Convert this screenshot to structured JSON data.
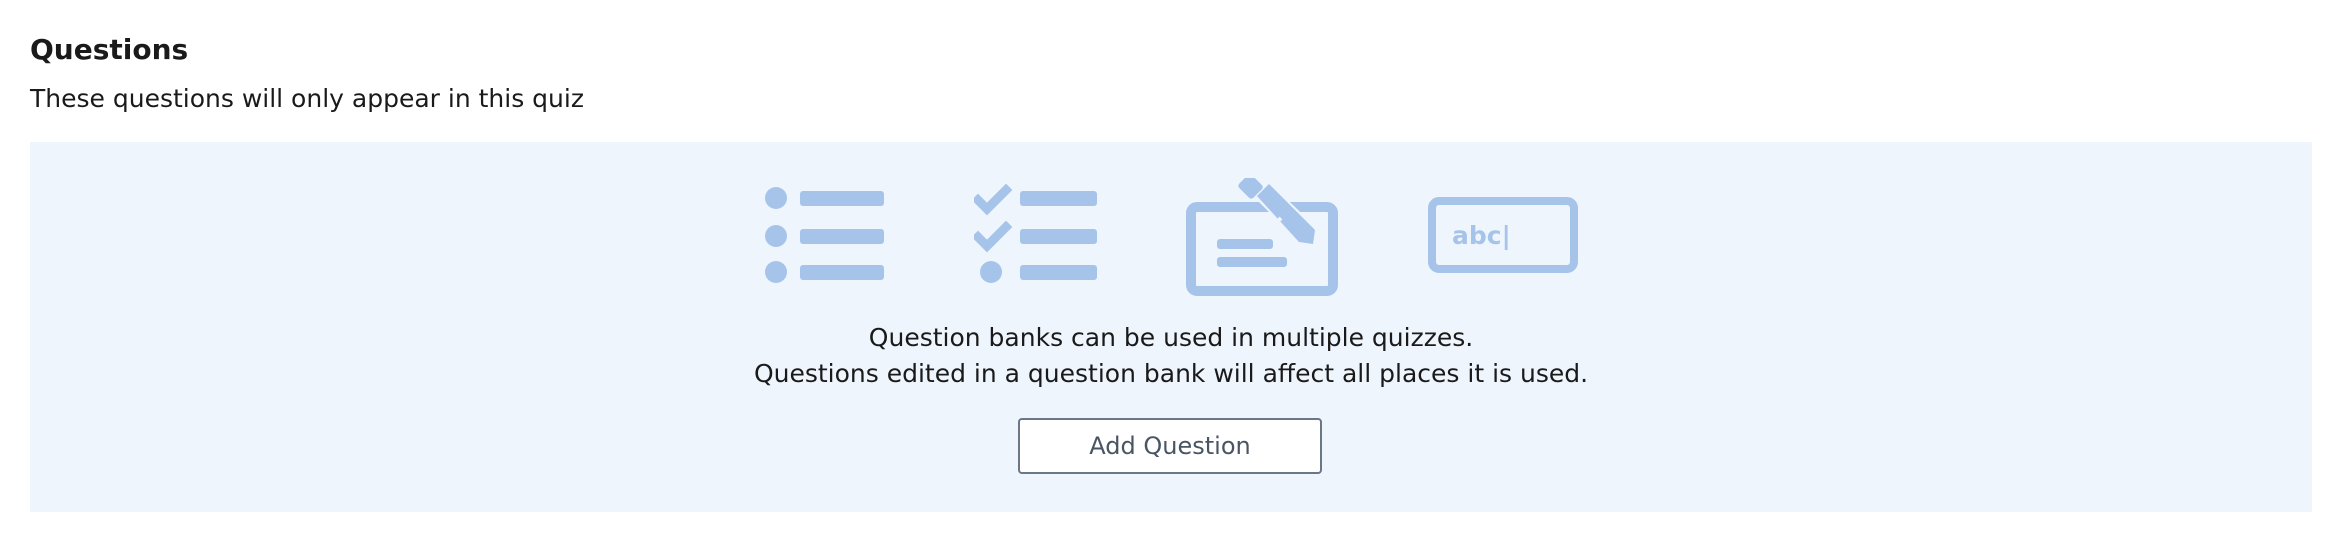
{
  "section": {
    "title": "Questions",
    "subtitle": "These questions will only appear in this quiz"
  },
  "empty_state": {
    "icons": [
      "bulleted-list-icon",
      "checklist-icon",
      "essay-edit-icon",
      "text-entry-icon"
    ],
    "text_entry_sample": "abc|",
    "line1": "Question banks can be used in multiple quizzes.",
    "line2": "Questions edited in a question bank will affect all places it is used.",
    "button_label": "Add Question"
  },
  "colors": {
    "panel_bg": "#eef5fd",
    "icon": "#a6c4ea",
    "button_border": "#6b7787",
    "button_text": "#4a5563"
  }
}
